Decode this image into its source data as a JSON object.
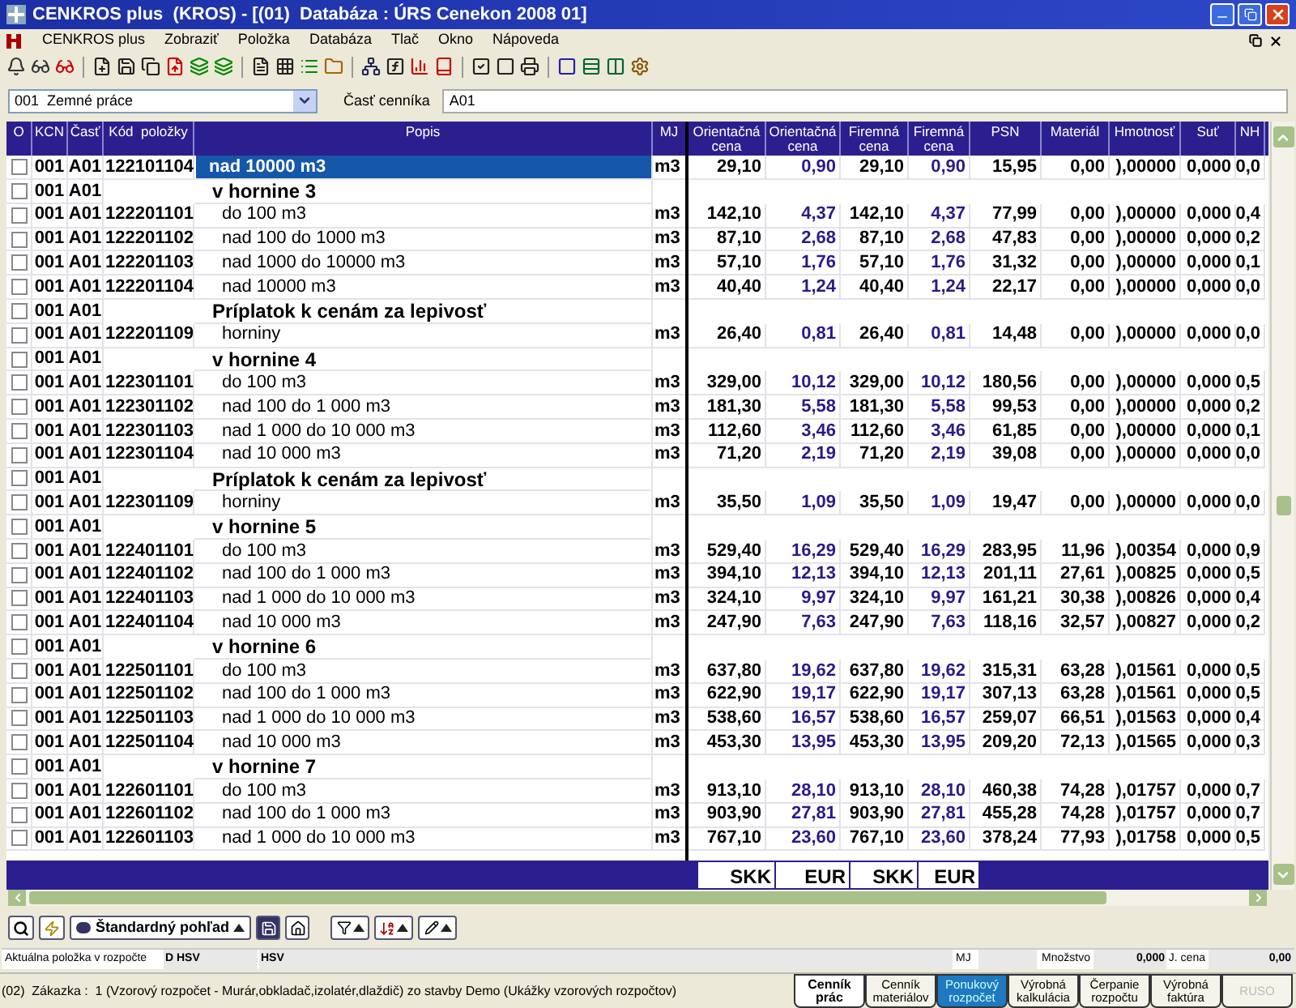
{
  "window": {
    "title": "CENKROS plus  (KROS) - [(01)  Databáza : ÚRS Cenekon 2008 01]"
  },
  "menu": [
    "CENKROS plus",
    "Zobraziť",
    "Položka",
    "Databáza",
    "Tlač",
    "Okno",
    "Nápoveda"
  ],
  "filter": {
    "section": "001  Zemné práce",
    "part_label": "Časť cenníka",
    "part_value": "A01"
  },
  "table": {
    "columns": [
      "O",
      "KCN",
      "Časť",
      "Kód  položky",
      "Popis",
      "MJ",
      "Orientačná cena",
      "Orientačná cena",
      "Firemná cena",
      "Firemná cena",
      "PSN",
      "Materiál",
      "Hmotnosť",
      "Suť",
      "NH"
    ],
    "rows": [
      {
        "kind": "item",
        "selected": true,
        "checked": false,
        "kcn": "001",
        "part": "A01",
        "code": "122101104",
        "description": "nad 10000 m3",
        "unit": "m3",
        "values": [
          "29,10",
          "0,90",
          "29,10",
          "0,90",
          "15,95",
          "0,00",
          "),00000",
          "0,000",
          "0,0"
        ]
      },
      {
        "kind": "group",
        "selected": false,
        "checked": false,
        "kcn": "001",
        "part": "A01",
        "description": "v hornine 3"
      },
      {
        "kind": "item",
        "selected": false,
        "checked": false,
        "kcn": "001",
        "part": "A01",
        "code": "122201101",
        "description": "do 100 m3",
        "unit": "m3",
        "values": [
          "142,10",
          "4,37",
          "142,10",
          "4,37",
          "77,99",
          "0,00",
          "),00000",
          "0,000",
          "0,4"
        ]
      },
      {
        "kind": "item",
        "selected": false,
        "checked": false,
        "kcn": "001",
        "part": "A01",
        "code": "122201102",
        "description": "nad 100 do 1000 m3",
        "unit": "m3",
        "values": [
          "87,10",
          "2,68",
          "87,10",
          "2,68",
          "47,83",
          "0,00",
          "),00000",
          "0,000",
          "0,2"
        ]
      },
      {
        "kind": "item",
        "selected": false,
        "checked": false,
        "kcn": "001",
        "part": "A01",
        "code": "122201103",
        "description": "nad 1000 do 10000 m3",
        "unit": "m3",
        "values": [
          "57,10",
          "1,76",
          "57,10",
          "1,76",
          "31,32",
          "0,00",
          "),00000",
          "0,000",
          "0,1"
        ]
      },
      {
        "kind": "item",
        "selected": false,
        "checked": false,
        "kcn": "001",
        "part": "A01",
        "code": "122201104",
        "description": "nad 10000 m3",
        "unit": "m3",
        "values": [
          "40,40",
          "1,24",
          "40,40",
          "1,24",
          "22,17",
          "0,00",
          "),00000",
          "0,000",
          "0,0"
        ]
      },
      {
        "kind": "group",
        "selected": false,
        "checked": false,
        "kcn": "001",
        "part": "A01",
        "description": "Príplatok k cenám za lepivosť"
      },
      {
        "kind": "item",
        "selected": false,
        "checked": false,
        "kcn": "001",
        "part": "A01",
        "code": "122201109",
        "description": "horniny",
        "unit": "m3",
        "values": [
          "26,40",
          "0,81",
          "26,40",
          "0,81",
          "14,48",
          "0,00",
          "),00000",
          "0,000",
          "0,0"
        ]
      },
      {
        "kind": "group",
        "selected": false,
        "checked": false,
        "kcn": "001",
        "part": "A01",
        "description": "v hornine 4"
      },
      {
        "kind": "item",
        "selected": false,
        "checked": false,
        "kcn": "001",
        "part": "A01",
        "code": "122301101",
        "description": "do 100 m3",
        "unit": "m3",
        "values": [
          "329,00",
          "10,12",
          "329,00",
          "10,12",
          "180,56",
          "0,00",
          "),00000",
          "0,000",
          "0,5"
        ]
      },
      {
        "kind": "item",
        "selected": false,
        "checked": false,
        "kcn": "001",
        "part": "A01",
        "code": "122301102",
        "description": "nad 100 do 1 000 m3",
        "unit": "m3",
        "values": [
          "181,30",
          "5,58",
          "181,30",
          "5,58",
          "99,53",
          "0,00",
          "),00000",
          "0,000",
          "0,2"
        ]
      },
      {
        "kind": "item",
        "selected": false,
        "checked": false,
        "kcn": "001",
        "part": "A01",
        "code": "122301103",
        "description": "nad 1 000 do 10 000 m3",
        "unit": "m3",
        "values": [
          "112,60",
          "3,46",
          "112,60",
          "3,46",
          "61,85",
          "0,00",
          "),00000",
          "0,000",
          "0,1"
        ]
      },
      {
        "kind": "item",
        "selected": false,
        "checked": false,
        "kcn": "001",
        "part": "A01",
        "code": "122301104",
        "description": "nad 10 000 m3",
        "unit": "m3",
        "values": [
          "71,20",
          "2,19",
          "71,20",
          "2,19",
          "39,08",
          "0,00",
          "),00000",
          "0,000",
          "0,0"
        ]
      },
      {
        "kind": "group",
        "selected": false,
        "checked": false,
        "kcn": "001",
        "part": "A01",
        "description": "Príplatok k cenám za lepivosť"
      },
      {
        "kind": "item",
        "selected": false,
        "checked": false,
        "kcn": "001",
        "part": "A01",
        "code": "122301109",
        "description": "horniny",
        "unit": "m3",
        "values": [
          "35,50",
          "1,09",
          "35,50",
          "1,09",
          "19,47",
          "0,00",
          "),00000",
          "0,000",
          "0,0"
        ]
      },
      {
        "kind": "group",
        "selected": false,
        "checked": false,
        "kcn": "001",
        "part": "A01",
        "description": "v hornine 5"
      },
      {
        "kind": "item",
        "selected": false,
        "checked": false,
        "kcn": "001",
        "part": "A01",
        "code": "122401101",
        "description": "do 100 m3",
        "unit": "m3",
        "values": [
          "529,40",
          "16,29",
          "529,40",
          "16,29",
          "283,95",
          "11,96",
          "),00354",
          "0,000",
          "0,9"
        ]
      },
      {
        "kind": "item",
        "selected": false,
        "checked": false,
        "kcn": "001",
        "part": "A01",
        "code": "122401102",
        "description": "nad 100 do 1 000 m3",
        "unit": "m3",
        "values": [
          "394,10",
          "12,13",
          "394,10",
          "12,13",
          "201,11",
          "27,61",
          "),00825",
          "0,000",
          "0,5"
        ]
      },
      {
        "kind": "item",
        "selected": false,
        "checked": false,
        "kcn": "001",
        "part": "A01",
        "code": "122401103",
        "description": "nad 1 000 do 10 000 m3",
        "unit": "m3",
        "values": [
          "324,10",
          "9,97",
          "324,10",
          "9,97",
          "161,21",
          "30,38",
          "),00826",
          "0,000",
          "0,4"
        ]
      },
      {
        "kind": "item",
        "selected": false,
        "checked": false,
        "kcn": "001",
        "part": "A01",
        "code": "122401104",
        "description": "nad 10 000 m3",
        "unit": "m3",
        "values": [
          "247,90",
          "7,63",
          "247,90",
          "7,63",
          "118,16",
          "32,57",
          "),00827",
          "0,000",
          "0,2"
        ]
      },
      {
        "kind": "group",
        "selected": false,
        "checked": false,
        "kcn": "001",
        "part": "A01",
        "description": "v hornine 6"
      },
      {
        "kind": "item",
        "selected": false,
        "checked": false,
        "kcn": "001",
        "part": "A01",
        "code": "122501101",
        "description": "do 100 m3",
        "unit": "m3",
        "values": [
          "637,80",
          "19,62",
          "637,80",
          "19,62",
          "315,31",
          "63,28",
          "),01561",
          "0,000",
          "0,5"
        ]
      },
      {
        "kind": "item",
        "selected": false,
        "checked": false,
        "kcn": "001",
        "part": "A01",
        "code": "122501102",
        "description": "nad 100 do 1 000 m3",
        "unit": "m3",
        "values": [
          "622,90",
          "19,17",
          "622,90",
          "19,17",
          "307,13",
          "63,28",
          "),01561",
          "0,000",
          "0,5"
        ]
      },
      {
        "kind": "item",
        "selected": false,
        "checked": false,
        "kcn": "001",
        "part": "A01",
        "code": "122501103",
        "description": "nad 1 000 do 10 000 m3",
        "unit": "m3",
        "values": [
          "538,60",
          "16,57",
          "538,60",
          "16,57",
          "259,07",
          "66,51",
          "),01563",
          "0,000",
          "0,4"
        ]
      },
      {
        "kind": "item",
        "selected": false,
        "checked": false,
        "kcn": "001",
        "part": "A01",
        "code": "122501104",
        "description": "nad 10 000 m3",
        "unit": "m3",
        "values": [
          "453,30",
          "13,95",
          "453,30",
          "13,95",
          "209,20",
          "72,13",
          "),01565",
          "0,000",
          "0,3"
        ]
      },
      {
        "kind": "group",
        "selected": false,
        "checked": false,
        "kcn": "001",
        "part": "A01",
        "description": "v hornine 7"
      },
      {
        "kind": "item",
        "selected": false,
        "checked": false,
        "kcn": "001",
        "part": "A01",
        "code": "122601101",
        "description": "do 100 m3",
        "unit": "m3",
        "values": [
          "913,10",
          "28,10",
          "913,10",
          "28,10",
          "460,38",
          "74,28",
          "),01757",
          "0,000",
          "0,7"
        ]
      },
      {
        "kind": "item",
        "selected": false,
        "checked": false,
        "kcn": "001",
        "part": "A01",
        "code": "122601102",
        "description": "nad 100 do 1 000 m3",
        "unit": "m3",
        "values": [
          "903,90",
          "27,81",
          "903,90",
          "27,81",
          "455,28",
          "74,28",
          "),01757",
          "0,000",
          "0,7"
        ]
      },
      {
        "kind": "item",
        "selected": false,
        "checked": false,
        "kcn": "001",
        "part": "A01",
        "code": "122601103",
        "description": "nad 1 000 do 10 000 m3",
        "unit": "m3",
        "values": [
          "767,10",
          "23,60",
          "767,10",
          "23,60",
          "378,24",
          "77,93",
          "),01758",
          "0,000",
          "0,5"
        ]
      }
    ],
    "totals": [
      "SKK",
      "EUR",
      "SKK",
      "EUR"
    ]
  },
  "bottom_toolbar": {
    "view": "Štandardný pohľad"
  },
  "current_item": {
    "label": "Aktuálna položka v rozpočte",
    "code": "D HSV",
    "name": "HSV",
    "unit_label": "MJ",
    "quantity_label": "Množstvo",
    "quantity": "0,000",
    "price_label": "J. cena",
    "price": "0,00"
  },
  "status": "(02)  Zákazka :  1 (Vzorový rozpočet - Murár,obkladač,izolatér,dlaždič) zo stavby Demo (Ukážky vzorových rozpočtov)",
  "tabs": [
    {
      "label": "Cenník prác",
      "selected": true,
      "highlighted": false,
      "disabled": false
    },
    {
      "label": "Cenník materiálov",
      "selected": false,
      "highlighted": false,
      "disabled": false
    },
    {
      "label": "Ponukový rozpočet",
      "selected": false,
      "highlighted": true,
      "disabled": false
    },
    {
      "label": "Výrobná kalkulácia",
      "selected": false,
      "highlighted": false,
      "disabled": false
    },
    {
      "label": "Čerpanie rozpočtu",
      "selected": false,
      "highlighted": false,
      "disabled": false
    },
    {
      "label": "Výrobná faktúra",
      "selected": false,
      "highlighted": false,
      "disabled": false
    },
    {
      "label": "RUSO",
      "selected": false,
      "highlighted": false,
      "disabled": true
    }
  ]
}
